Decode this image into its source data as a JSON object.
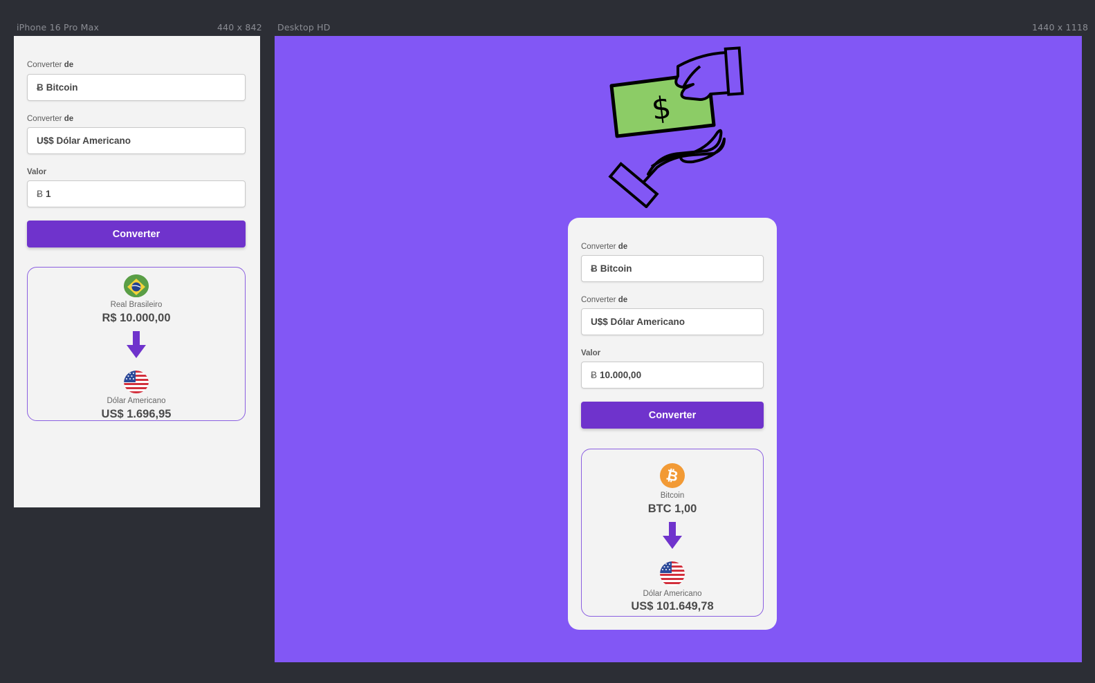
{
  "frames": {
    "phone": {
      "name": "iPhone 16 Pro Max",
      "size": "440 x 842"
    },
    "desktop": {
      "name": "Desktop HD",
      "size": "1440 x 1118"
    }
  },
  "colors": {
    "background": "#2c2e35",
    "accent": "#6f33cc",
    "desktop_bg": "#8257f5",
    "card_bg": "#f3f3f3"
  },
  "phone": {
    "from_label_prefix": "Converter ",
    "from_label_bold": "de",
    "from_symbol": "Ƀ",
    "from_value": "Bitcoin",
    "to_label_prefix": "Converter ",
    "to_label_bold": "de",
    "to_value": "U$$ Dólar Americano",
    "amount_label": "Valor",
    "amount_symbol": "Ƀ",
    "amount_value": "1",
    "button_label": "Converter",
    "result": {
      "from_icon": "brazil-flag-icon",
      "from_name": "Real Brasileiro",
      "from_value": "R$ 10.000,00",
      "to_icon": "usa-flag-icon",
      "to_name": "Dólar Americano",
      "to_value": "US$ 1.696,95"
    }
  },
  "desktop": {
    "hero_icon": "money-hand-exchange-icon",
    "hero_symbol": "$",
    "from_label_prefix": "Converter ",
    "from_label_bold": "de",
    "from_symbol": "Ƀ",
    "from_value": "Bitcoin",
    "to_label_prefix": "Converter ",
    "to_label_bold": "de",
    "to_value": "U$$ Dólar Americano",
    "amount_label": "Valor",
    "amount_symbol": "Ƀ",
    "amount_value": "10.000,00",
    "button_label": "Converter",
    "result": {
      "from_icon": "bitcoin-icon",
      "from_symbol": "₿",
      "from_name": "Bitcoin",
      "from_value": "BTC 1,00",
      "to_icon": "usa-flag-icon",
      "to_name": "Dólar Americano",
      "to_value": "US$ 101.649,78"
    }
  }
}
